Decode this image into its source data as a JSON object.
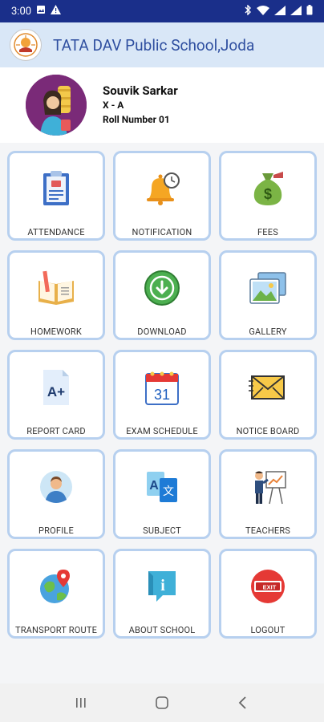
{
  "status": {
    "time": "3:00"
  },
  "app": {
    "title": "TATA DAV Public School,Joda"
  },
  "profile": {
    "name": "Souvik Sarkar",
    "class": "X - A",
    "roll": "Roll Number  01"
  },
  "menu": [
    {
      "label": "ATTENDANCE",
      "icon": "clipboard-icon"
    },
    {
      "label": "NOTIFICATION",
      "icon": "bell-clock-icon"
    },
    {
      "label": "FEES",
      "icon": "money-bag-icon"
    },
    {
      "label": "HOMEWORK",
      "icon": "book-pencil-icon"
    },
    {
      "label": "DOWNLOAD",
      "icon": "download-icon"
    },
    {
      "label": "GALLERY",
      "icon": "pictures-icon"
    },
    {
      "label": "REPORT CARD",
      "icon": "report-card-icon",
      "grade": "A+"
    },
    {
      "label": "EXAM SCHEDULE",
      "icon": "calendar-icon",
      "day": "31"
    },
    {
      "label": "NOTICE BOARD",
      "icon": "envelope-icon"
    },
    {
      "label": "PROFILE",
      "icon": "user-icon"
    },
    {
      "label": "SUBJECT",
      "icon": "translate-icon",
      "glyph_a": "A",
      "glyph_b": "文"
    },
    {
      "label": "TEACHERS",
      "icon": "teacher-board-icon"
    },
    {
      "label": "TRANSPORT ROUTE",
      "icon": "globe-pin-icon"
    },
    {
      "label": "ABOUT SCHOOL",
      "icon": "info-icon",
      "glyph": "i"
    },
    {
      "label": "LOGOUT",
      "icon": "exit-icon",
      "glyph": "EXIT"
    }
  ]
}
